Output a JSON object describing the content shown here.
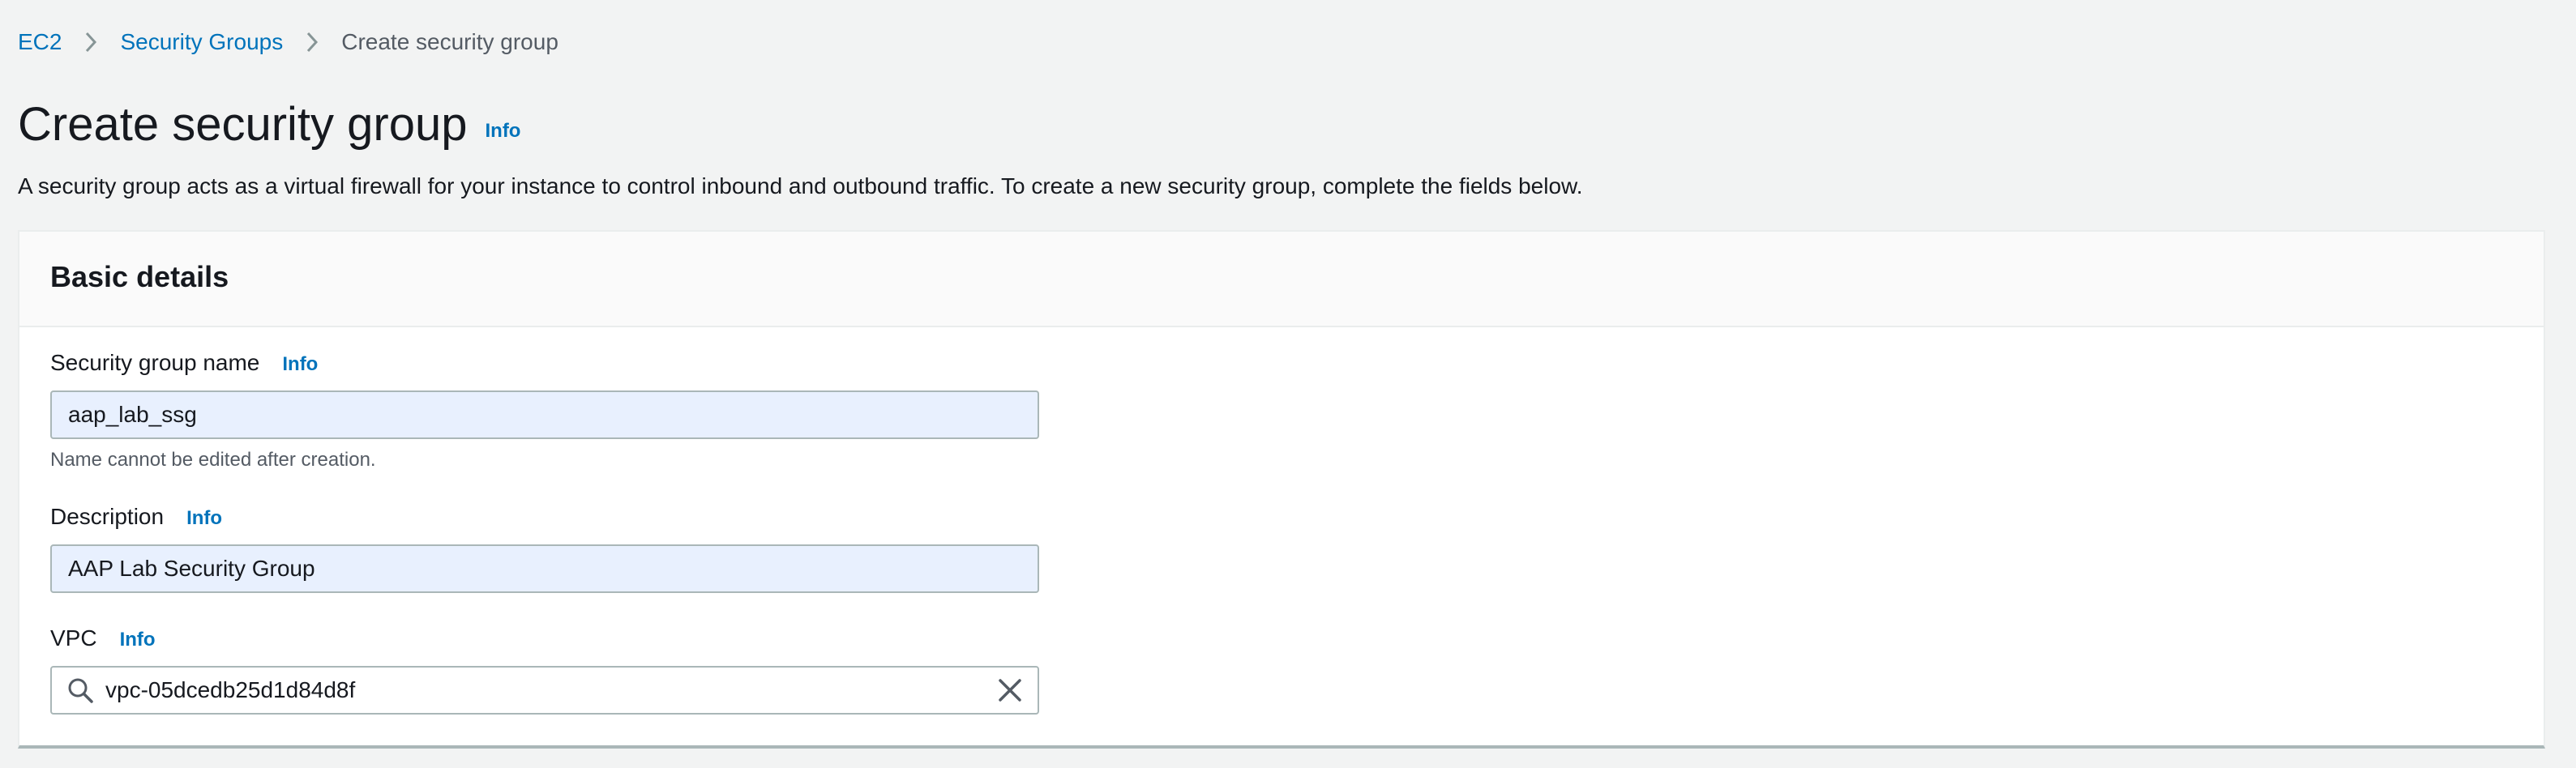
{
  "breadcrumb": {
    "items": [
      "EC2",
      "Security Groups"
    ],
    "current": "Create security group"
  },
  "page": {
    "title": "Create security group",
    "info_label": "Info",
    "description": "A security group acts as a virtual firewall for your instance to control inbound and outbound traffic. To create a new security group, complete the fields below."
  },
  "basic_details": {
    "title": "Basic details",
    "name_field": {
      "label": "Security group name",
      "info_label": "Info",
      "value": "aap_lab_ssg",
      "helper": "Name cannot be edited after creation."
    },
    "description_field": {
      "label": "Description",
      "info_label": "Info",
      "value": "AAP Lab Security Group"
    },
    "vpc_field": {
      "label": "VPC",
      "info_label": "Info",
      "value": "vpc-05dcedb25d1d84d8f"
    }
  },
  "icons": {
    "breadcrumb_separator": "chevron-right-icon",
    "search": "search-icon",
    "clear": "close-icon"
  },
  "colors": {
    "link": "#0073bb",
    "page_background": "#f2f3f3",
    "autofill_input": "#e8f0fe"
  }
}
